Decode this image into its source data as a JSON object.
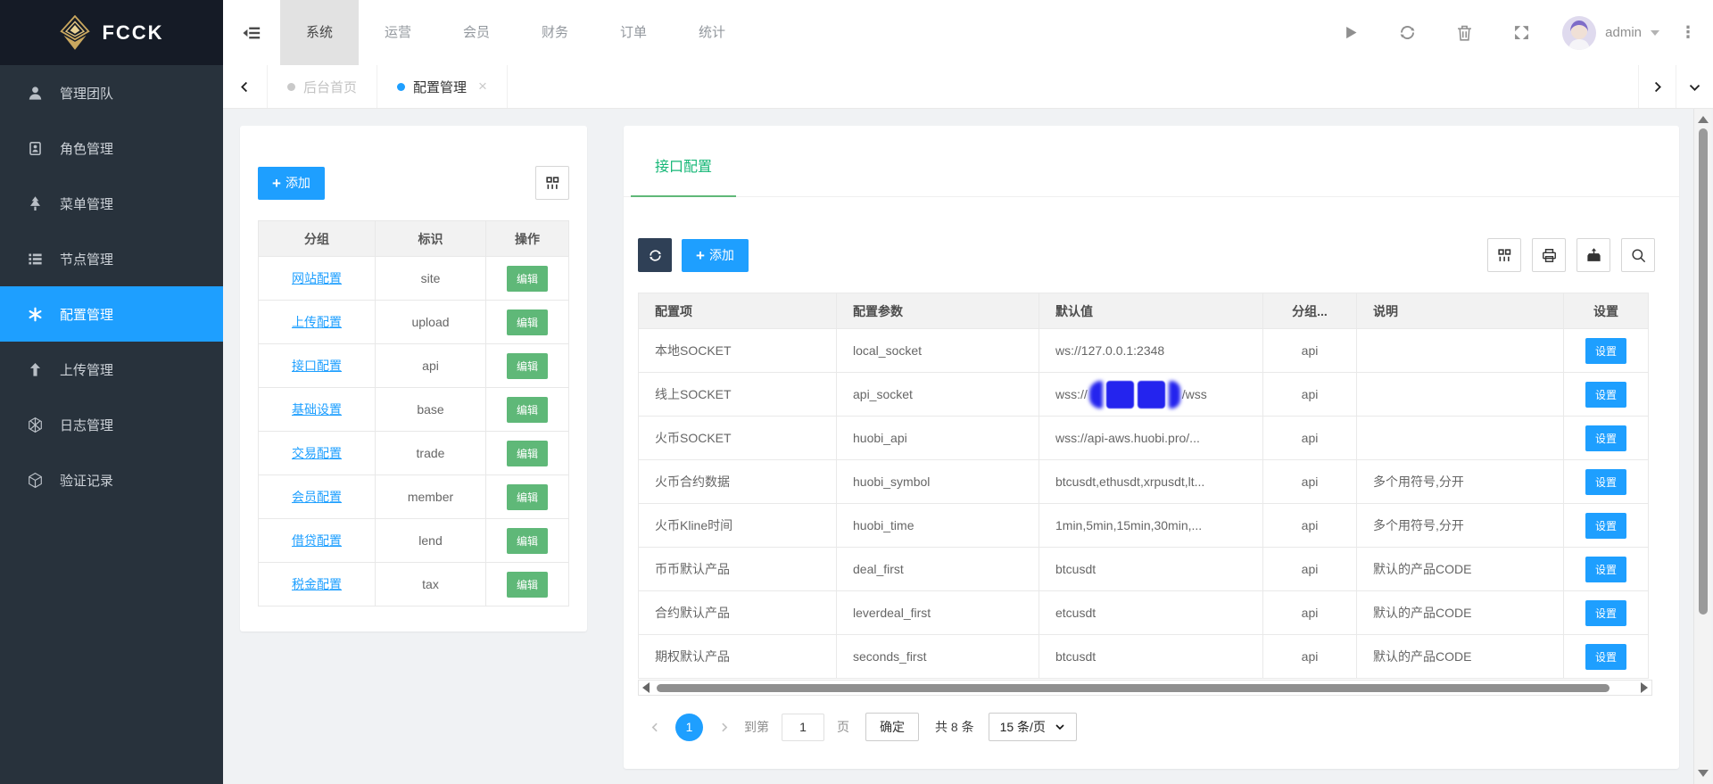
{
  "colors": {
    "accent_blue": "#1E9FFF",
    "green": "#5FB878",
    "teal_tab": "#16B777",
    "dark_button": "#2F4056",
    "sidebar_bg": "#28323C",
    "logo_bg": "#151B26",
    "active_nav_bg": "#E2E2E2",
    "table_header_bg": "#F2F2F2",
    "redaction_blue": "#2424EE",
    "gold_logo": "#C9A75E"
  },
  "topbar": {
    "logo_text": "FCCK",
    "nav": [
      {
        "id": "system",
        "label": "系统",
        "active": true
      },
      {
        "id": "operation",
        "label": "运营",
        "active": false
      },
      {
        "id": "member",
        "label": "会员",
        "active": false
      },
      {
        "id": "finance",
        "label": "财务",
        "active": false
      },
      {
        "id": "order",
        "label": "订单",
        "active": false
      },
      {
        "id": "stats",
        "label": "统计",
        "active": false
      }
    ],
    "username": "admin"
  },
  "sidebar": {
    "items": [
      {
        "id": "team",
        "label": "管理团队",
        "icon": "user-icon",
        "active": false
      },
      {
        "id": "role",
        "label": "角色管理",
        "icon": "id-badge-icon",
        "active": false
      },
      {
        "id": "menu",
        "label": "菜单管理",
        "icon": "tree-icon",
        "active": false
      },
      {
        "id": "node",
        "label": "节点管理",
        "icon": "list-icon",
        "active": false
      },
      {
        "id": "config",
        "label": "配置管理",
        "icon": "asterisk-icon",
        "active": true
      },
      {
        "id": "upload",
        "label": "上传管理",
        "icon": "arrow-up-icon",
        "active": false
      },
      {
        "id": "log",
        "label": "日志管理",
        "icon": "hexagon-icon",
        "active": false
      },
      {
        "id": "verify",
        "label": "验证记录",
        "icon": "cube-icon",
        "active": false
      }
    ]
  },
  "tabbar": {
    "tabs": [
      {
        "id": "home",
        "label": "后台首页",
        "active": false,
        "closable": false
      },
      {
        "id": "config",
        "label": "配置管理",
        "active": true,
        "closable": true
      }
    ]
  },
  "left_panel": {
    "add_label": "添加",
    "table": {
      "headers": [
        "分组",
        "标识",
        "操作"
      ],
      "edit_label": "编辑",
      "rows": [
        {
          "group": "网站配置",
          "key": "site"
        },
        {
          "group": "上传配置",
          "key": "upload"
        },
        {
          "group": "接口配置",
          "key": "api"
        },
        {
          "group": "基础设置",
          "key": "base"
        },
        {
          "group": "交易配置",
          "key": "trade"
        },
        {
          "group": "会员配置",
          "key": "member"
        },
        {
          "group": "借贷配置",
          "key": "lend"
        },
        {
          "group": "税金配置",
          "key": "tax"
        }
      ]
    }
  },
  "right_panel": {
    "tab_label": "接口配置",
    "add_label": "添加",
    "table": {
      "headers": [
        "配置项",
        "配置参数",
        "默认值",
        "分组...",
        "说明",
        "设置"
      ],
      "set_label": "设置",
      "rows": [
        {
          "item": "本地SOCKET",
          "param": "local_socket",
          "value": "ws://127.0.0.1:2348",
          "value_redacted": false,
          "group": "api",
          "note": ""
        },
        {
          "item": "线上SOCKET",
          "param": "api_socket",
          "value_prefix": "wss://",
          "value_suffix": "/wss",
          "value_redacted": true,
          "group": "api",
          "note": ""
        },
        {
          "item": "火币SOCKET",
          "param": "huobi_api",
          "value": "wss://api-aws.huobi.pro/...",
          "value_redacted": false,
          "group": "api",
          "note": ""
        },
        {
          "item": "火币合约数据",
          "param": "huobi_symbol",
          "value": "btcusdt,ethusdt,xrpusdt,lt...",
          "value_redacted": false,
          "group": "api",
          "note": "多个用符号,分开"
        },
        {
          "item": "火币Kline时间",
          "param": "huobi_time",
          "value": "1min,5min,15min,30min,...",
          "value_redacted": false,
          "group": "api",
          "note": "多个用符号,分开"
        },
        {
          "item": "币币默认产品",
          "param": "deal_first",
          "value": "btcusdt",
          "value_redacted": false,
          "group": "api",
          "note": "默认的产品CODE"
        },
        {
          "item": "合约默认产品",
          "param": "leverdeal_first",
          "value": "etcusdt",
          "value_redacted": false,
          "group": "api",
          "note": "默认的产品CODE"
        },
        {
          "item": "期权默认产品",
          "param": "seconds_first",
          "value": "btcusdt",
          "value_redacted": false,
          "group": "api",
          "note": "默认的产品CODE"
        }
      ]
    },
    "pagination": {
      "current": "1",
      "goto_label": "到第",
      "page_input": "1",
      "page_label": "页",
      "confirm_label": "确定",
      "total_label": "共 8 条",
      "per_page": "15 条/页"
    }
  }
}
